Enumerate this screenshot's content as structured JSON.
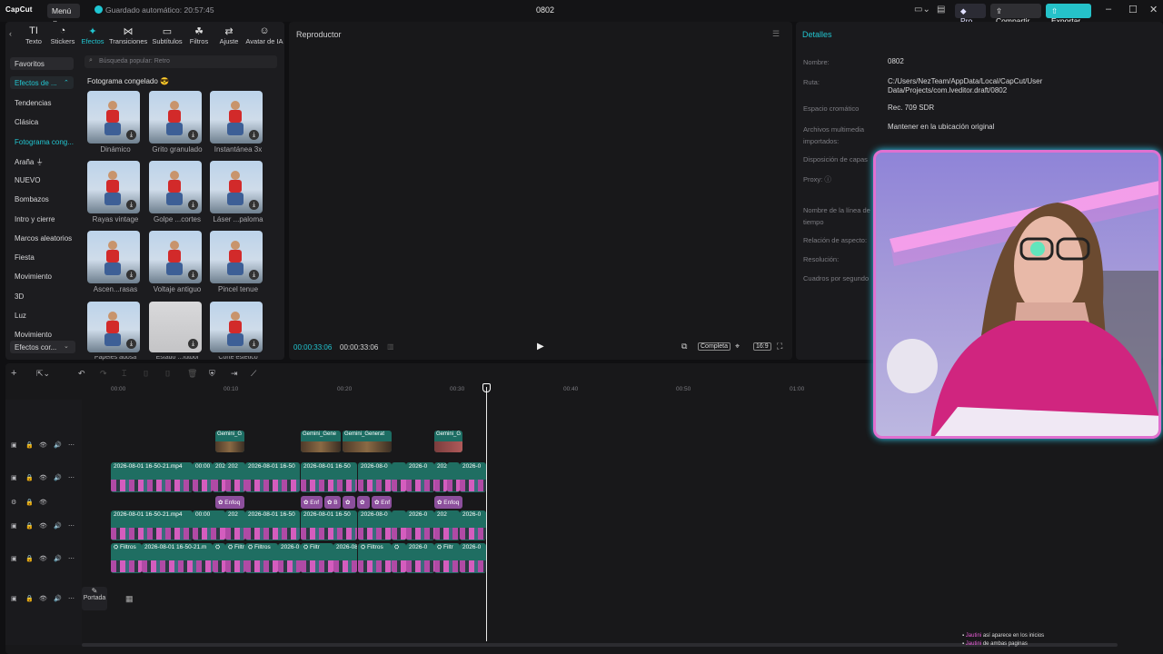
{
  "app": {
    "logo": "CapCut",
    "menu": "Menú",
    "autosave": "Guardado automático: 20:57:45",
    "title": "0802"
  },
  "topbar": {
    "pro": "Pro",
    "share": "Compartir",
    "export": "Exportar"
  },
  "tools": [
    {
      "label": "Texto",
      "icon": "TI"
    },
    {
      "label": "Stickers",
      "icon": "◔"
    },
    {
      "label": "Efectos",
      "icon": "✦"
    },
    {
      "label": "Transiciones",
      "icon": "⋈"
    },
    {
      "label": "Subtítulos",
      "icon": "▭"
    },
    {
      "label": "Filtros",
      "icon": "☘"
    },
    {
      "label": "Ajuste",
      "icon": "⇄"
    },
    {
      "label": "Avatar de IA",
      "icon": "☺"
    }
  ],
  "sidebar": {
    "items": [
      "Favoritos",
      "Efectos de ...",
      "Tendencias",
      "Clásica",
      "Fotograma cong...",
      "Araña ⏚",
      "NUEVO",
      "Bombazos",
      "Intro y cierre",
      "Marcos aleatorios",
      "Fiesta",
      "Movimiento",
      "3D",
      "Luz",
      "Movimiento"
    ],
    "bottom": "Efectos cor..."
  },
  "search": {
    "placeholder": "Búsqueda popular: Retro"
  },
  "section_title": "Fotograma congelado",
  "effects": [
    "Dinámico",
    "Grito granulado",
    "Instantánea 3x",
    "Rayas vintage",
    "Golpe ...cortes",
    "Láser ...paloma",
    "Ascen...rasas",
    "Voltaje antiguo",
    "Pincel tenue",
    "Papeles adosa",
    "Estado ...fútbol",
    "Corte estético"
  ],
  "player": {
    "title": "Reproductor",
    "time_current": "00:00:33:06",
    "time_total": "00:00:33:06",
    "mode": "Completa",
    "ratio": "16:9"
  },
  "details": {
    "title": "Detalles",
    "rows": [
      {
        "label": "Nombre:",
        "value": "0802"
      },
      {
        "label": "Ruta:",
        "value": "C:/Users/NezTeam/AppData/Local/CapCut/User Data/Projects/com.lveditor.draft/0802"
      },
      {
        "label": "Espacio cromático",
        "value": "Rec. 709 SDR"
      },
      {
        "label": "Archivos multimedia importados:",
        "value": "Mantener en la ubicación original"
      },
      {
        "label": "Disposición de capas",
        "value": ""
      },
      {
        "label": "Proxy: ⓘ",
        "value": ""
      },
      {
        "label": "Nombre de la línea de tiempo",
        "value": ""
      },
      {
        "label": "Relación de aspecto:",
        "value": ""
      },
      {
        "label": "Resolución:",
        "value": ""
      },
      {
        "label": "Cuadros por segundo",
        "value": ""
      }
    ]
  },
  "ruler": [
    "00:00",
    "00:10",
    "00:20",
    "00:30",
    "00:40",
    "00:50",
    "01:00"
  ],
  "tracks": {
    "gemini": [
      "Gemini_G",
      "Gemini_Gene",
      "Gemini_Generat",
      "Gemini_G"
    ],
    "video_label": "2026-08-01 16-50-21.mp4",
    "video_short": [
      "00:00",
      "202",
      "2026-08-01 16-50",
      "2026-08-01 16-50",
      "2026-08-0",
      "2026-0",
      "202",
      "2026-0"
    ],
    "fx": [
      "Enfoq",
      "Enf",
      "B",
      "",
      "Enf",
      "Enfoq"
    ],
    "filters": [
      "Filtros",
      "2026-08-01 16-50-21.m",
      "Filtr",
      "Filtros",
      "2026-0",
      "2026-08-0",
      "Filtros",
      "2026-0",
      "Filtr",
      "2026-0"
    ],
    "cover": "Portada"
  },
  "chat": [
    {
      "user": "Jautini",
      "msg": "así aparece en los inicios"
    },
    {
      "user": "Jautini",
      "msg": "de ambas paginas"
    }
  ]
}
